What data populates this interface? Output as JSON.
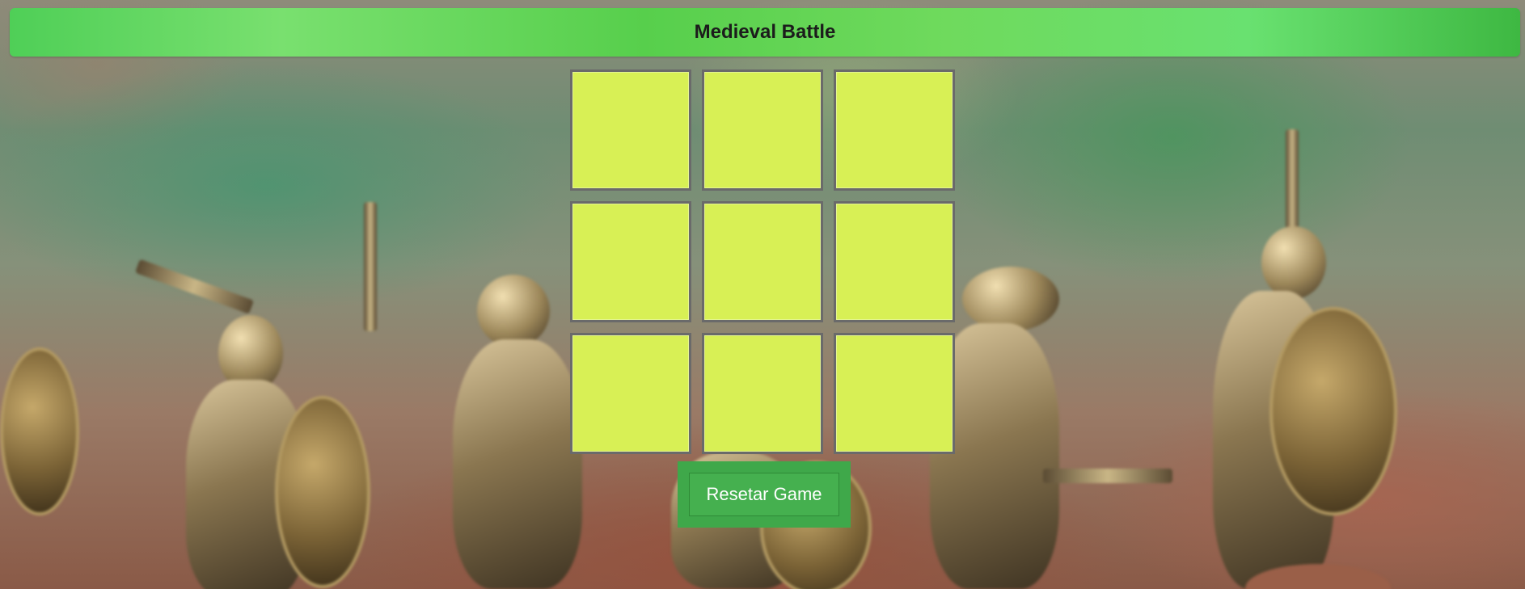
{
  "header": {
    "title": "Medieval Battle"
  },
  "board": {
    "cells": [
      "",
      "",
      "",
      "",
      "",
      "",
      "",
      "",
      ""
    ]
  },
  "controls": {
    "reset_label": "Resetar Game"
  },
  "colors": {
    "title_bar": "#5fd35a",
    "cell_fill": "#d8f055",
    "cell_border": "#6a6a6a",
    "reset_button": "#45b04f"
  }
}
